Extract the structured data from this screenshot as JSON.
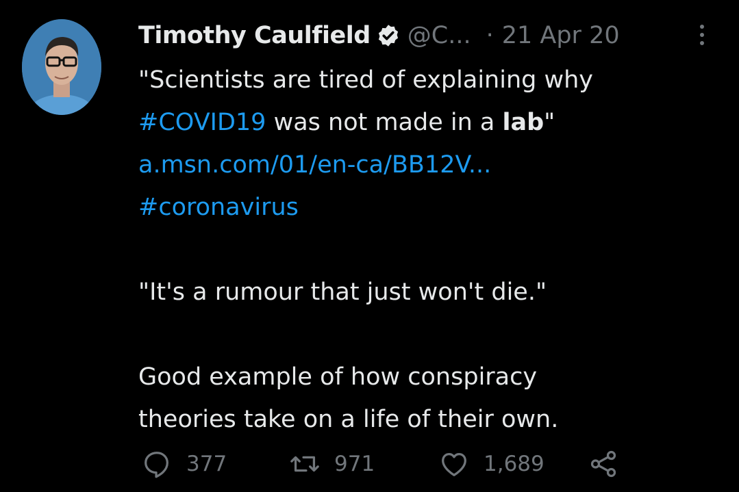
{
  "tweet": {
    "author_name": "Timothy Caulfield",
    "handle": "@C...",
    "separator": "·",
    "date": "21 Apr 20",
    "lines": {
      "l1": "\"Scientists are tired of explaining why",
      "l2_hashtag": "#COVID19",
      "l2_text": " was not made in a ",
      "l2_bold": "lab",
      "l2_end": "\"",
      "l3_link": "a.msn.com/01/en-ca/BB12V...",
      "l4_hashtag": "#coronavirus",
      "l5": "\"It's a rumour that just won't die.\"",
      "l6": "Good example of how conspiracy",
      "l7": "theories take on a life of their own."
    },
    "stats": {
      "replies": "377",
      "retweets": "971",
      "likes": "1,689"
    },
    "icons": {
      "verified": "verified-badge-icon",
      "more": "more-vertical-icon",
      "reply": "reply-icon",
      "retweet": "retweet-icon",
      "like": "heart-icon",
      "share": "share-icon"
    },
    "colors": {
      "background": "#000000",
      "text": "#e7e9ea",
      "muted": "#71767b",
      "link": "#1d9bf0"
    }
  }
}
